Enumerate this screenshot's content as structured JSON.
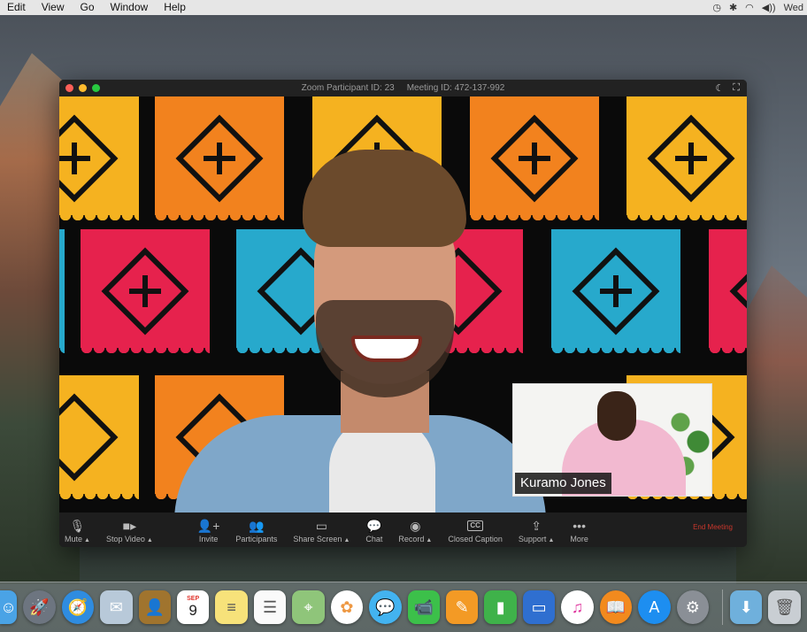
{
  "menubar": {
    "items": [
      "Edit",
      "View",
      "Go",
      "Window",
      "Help"
    ],
    "clock": "Wed"
  },
  "window": {
    "participant_id": "Zoom Participant ID: 23",
    "meeting_id": "Meeting ID: 472-137-992"
  },
  "selfview": {
    "name": "Kuramo Jones"
  },
  "toolbar": {
    "mute": "Mute",
    "stop_video": "Stop Video",
    "invite": "Invite",
    "participants": "Participants",
    "share_screen": "Share Screen",
    "chat": "Chat",
    "record": "Record",
    "closed_caption": "Closed Caption",
    "cc_icon": "CC",
    "support": "Support",
    "more": "More",
    "end_meeting": "End Meeting"
  },
  "dock": {
    "icons": [
      "finder-icon",
      "launchpad-icon",
      "safari-icon",
      "mail-icon",
      "contacts-icon",
      "calendar-icon",
      "notes-icon",
      "reminders-icon",
      "maps-icon",
      "photos-icon",
      "messages-icon",
      "facetime-icon",
      "pages-icon",
      "numbers-icon",
      "keynote-icon",
      "itunes-icon",
      "ibooks-icon",
      "appstore-icon",
      "system-preferences-icon",
      "downloads-folder-icon",
      "trash-icon"
    ],
    "calendar_month": "SEP",
    "calendar_day": "9"
  }
}
